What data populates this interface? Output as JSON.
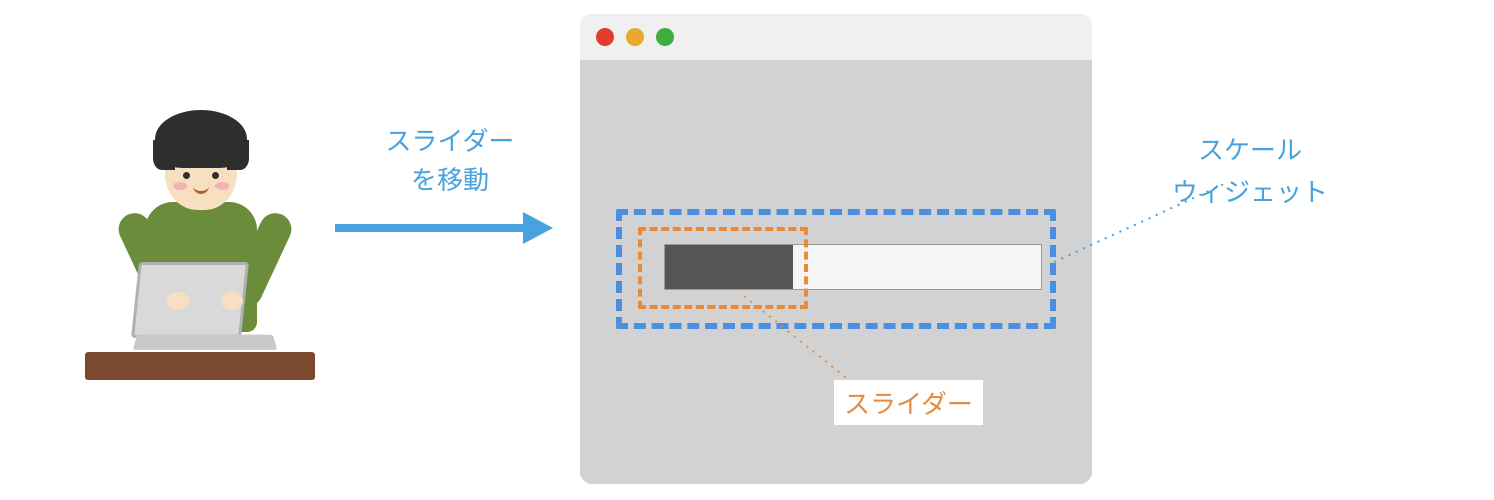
{
  "arrow": {
    "line1": "スライダー",
    "line2": "を移動"
  },
  "callouts": {
    "slider": "スライダー",
    "scale_line1": "スケール",
    "scale_line2": "ウィジェット"
  },
  "colors": {
    "accent_blue": "#49a2de",
    "accent_orange": "#e98a3a",
    "window_bg": "#d2d2d2",
    "slider_fill": "#555555"
  },
  "slider": {
    "fill_percent": 34
  }
}
